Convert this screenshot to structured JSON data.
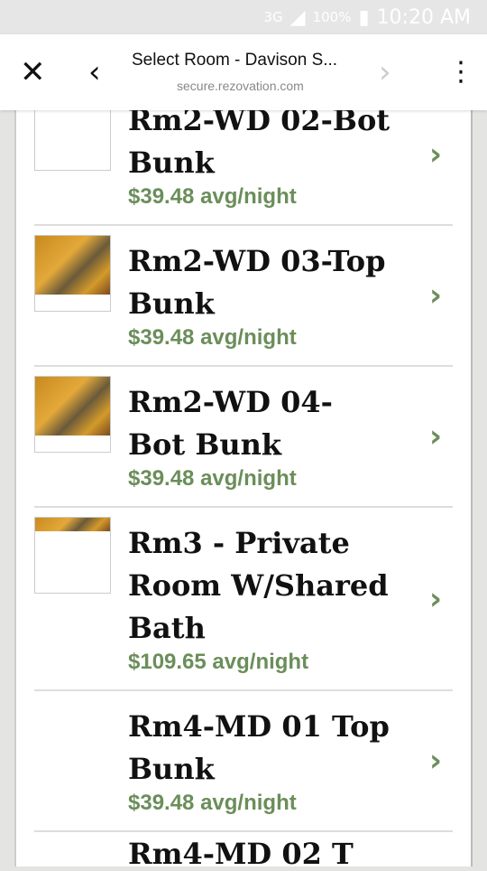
{
  "status": {
    "network": "3G",
    "battery": "100%",
    "time": "10:20 AM"
  },
  "toolbar": {
    "title": "Select Room - Davison S...",
    "url": "secure.rezovation.com"
  },
  "rooms": [
    {
      "name": "Rm2-WD 02-Bot Bunk",
      "price": "$39.48 avg/night",
      "thumb": "blank"
    },
    {
      "name": "Rm2-WD 03-Top Bunk",
      "price": "$39.48 avg/night",
      "thumb": "photo"
    },
    {
      "name": "Rm2-WD 04- Bot Bunk",
      "price": "$39.48 avg/night",
      "thumb": "photo"
    },
    {
      "name": "Rm3 - Private Room W/Shared Bath",
      "price": "$109.65 avg/night",
      "thumb": "partial"
    },
    {
      "name": "Rm4-MD 01 Top Bunk",
      "price": "$39.48 avg/night",
      "thumb": "none"
    },
    {
      "name": "Rm4-MD 02 T",
      "price": "",
      "thumb": "none"
    }
  ],
  "colors": {
    "accent": "#6b8e5a"
  }
}
